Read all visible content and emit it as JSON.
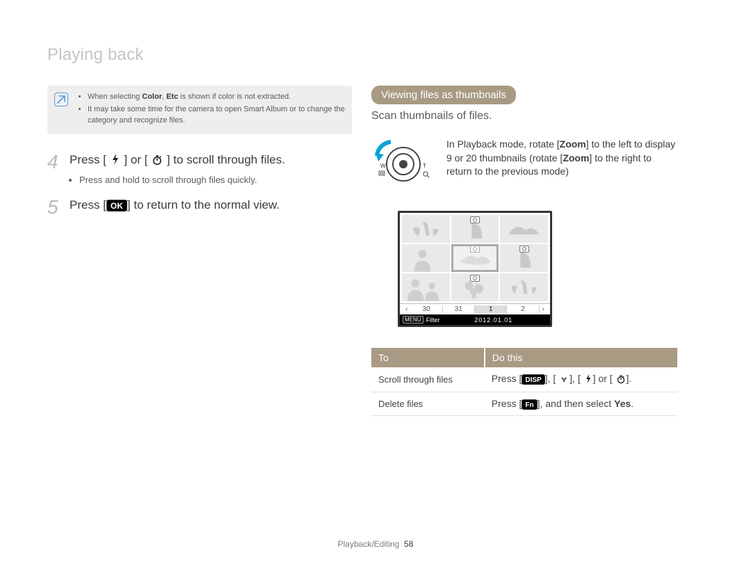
{
  "header": {
    "title": "Playing back"
  },
  "note": {
    "bullets": [
      {
        "pre": "When selecting ",
        "b1": "Color",
        "mid": ", ",
        "b2": "Etc",
        "post": " is shown if color is not extracted."
      },
      {
        "text": "It may take some time for the camera to open Smart Album or to change the category and recognize files."
      }
    ]
  },
  "steps": {
    "s4": {
      "num": "4",
      "pre": "Press [",
      "mid": "] or [",
      "post": "] to scroll through files.",
      "bullet": "Press and hold to scroll through files quickly."
    },
    "s5": {
      "num": "5",
      "pre": "Press [",
      "key": "OK",
      "post": "] to return to the normal view."
    }
  },
  "right": {
    "pill": "Viewing files as thumbnails",
    "intro": "Scan thumbnails of files.",
    "dial": {
      "pre": "In Playback mode, rotate [",
      "z1": "Zoom",
      "mid": "] to the left to display 9 or 20 thumbnails (rotate [",
      "z2": "Zoom",
      "post": "] to the right to return to the previous mode)"
    },
    "lcd": {
      "cal": [
        "30",
        "31",
        "1",
        "2"
      ],
      "menu": "MENU",
      "filter": "Filter",
      "date": "2012.01.01"
    },
    "table": {
      "head": {
        "to": "To",
        "do": "Do this"
      },
      "row1": {
        "to": "Scroll through files",
        "pre": "Press [",
        "k1": "DISP",
        "s1": "], [",
        "s2": "], [",
        "s3": "] or [",
        "post": "]."
      },
      "row2": {
        "to": "Delete files",
        "pre": "Press [",
        "k": "Fn",
        "mid": "], and then select ",
        "yes": "Yes",
        "post": "."
      }
    }
  },
  "footer": {
    "section": "Playback/Editing",
    "page": "58"
  }
}
